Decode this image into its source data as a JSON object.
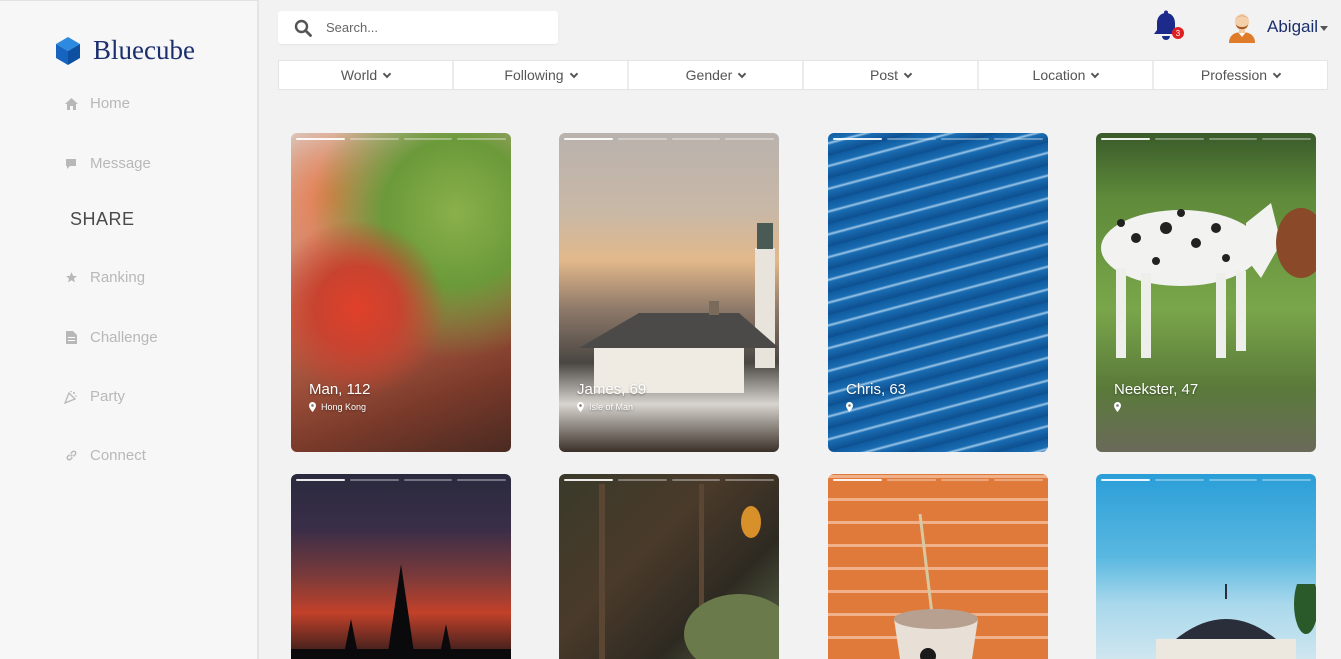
{
  "app": {
    "name": "Bluecube"
  },
  "sidebar": {
    "items": [
      {
        "label": "Home",
        "icon": "home-icon"
      },
      {
        "label": "Message",
        "icon": "message-icon"
      },
      {
        "label": "Ranking",
        "icon": "star-icon"
      },
      {
        "label": "Challenge",
        "icon": "document-icon"
      },
      {
        "label": "Party",
        "icon": "party-icon"
      },
      {
        "label": "Connect",
        "icon": "link-icon"
      }
    ],
    "section_heading": "SHARE"
  },
  "search": {
    "placeholder": "Search..."
  },
  "notifications": {
    "count": "3"
  },
  "user": {
    "name": "Abigail"
  },
  "filters": [
    "World",
    "Following",
    "Gender",
    "Post",
    "Location",
    "Profession"
  ],
  "cards": [
    {
      "name": "Man, 112",
      "location": "Hong Kong"
    },
    {
      "name": "James, 69",
      "location": "Isle of Man"
    },
    {
      "name": "Chris, 63",
      "location": ""
    },
    {
      "name": "Neekster, 47",
      "location": ""
    },
    {
      "name": "",
      "location": ""
    },
    {
      "name": "",
      "location": ""
    },
    {
      "name": "",
      "location": ""
    },
    {
      "name": "",
      "location": ""
    }
  ],
  "colors": {
    "brand": "#1b2f6e",
    "accent": "#1f7fd0",
    "badge": "#e02020"
  }
}
